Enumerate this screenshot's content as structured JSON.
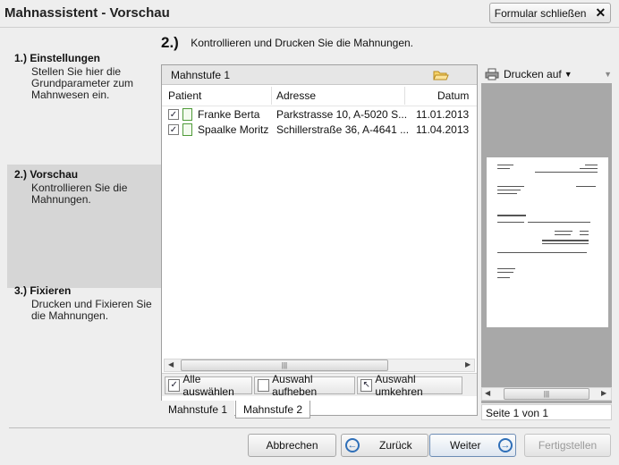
{
  "window": {
    "title": "Mahnassistent - Vorschau"
  },
  "header": {
    "close_button_label": "Formular schließen"
  },
  "sidebar": {
    "steps": [
      {
        "title": "1.) Einstellungen",
        "lines": [
          "Stellen Sie hier die",
          "Grundparameter zum",
          "Mahnwesen ein."
        ]
      },
      {
        "title": "2.) Vorschau",
        "lines": [
          "Kontrollieren Sie die",
          "Mahnungen."
        ]
      },
      {
        "title": "3.) Fixieren",
        "lines": [
          "Drucken und Fixieren Sie",
          "die Mahnungen."
        ]
      }
    ]
  },
  "main": {
    "step_number": "2.)",
    "instruction": "Kontrollieren und Drucken Sie die Mahnungen.",
    "group_header": "Mahnstufe 1",
    "columns": {
      "patient": "Patient",
      "address": "Adresse",
      "date": "Datum"
    },
    "rows": [
      {
        "patient": "Franke Berta",
        "address": "Parkstrasse 10, A-5020 S...",
        "date": "11.01.2013",
        "checked": true
      },
      {
        "patient": "Spaalke Moritz",
        "address": "Schillerstraße 36, A-4641 ...",
        "date": "11.04.2013",
        "checked": true
      }
    ],
    "buttons": {
      "select_all": "Alle auswählen",
      "deselect": "Auswahl aufheben",
      "invert": "Auswahl umkehren"
    },
    "tabs": [
      {
        "label": "Mahnstufe 1"
      },
      {
        "label": "Mahnstufe 2"
      }
    ]
  },
  "preview": {
    "print_label": "Drucken auf",
    "page_status": "Seite 1 von 1"
  },
  "footer": {
    "cancel": "Abbrechen",
    "back": "Zurück",
    "next": "Weiter",
    "finish": "Fertigstellen"
  },
  "icons": {
    "close": "close-icon",
    "folder": "folder-icon",
    "printer": "printer-icon",
    "back": "arrow-left-icon",
    "next": "arrow-right-icon"
  }
}
